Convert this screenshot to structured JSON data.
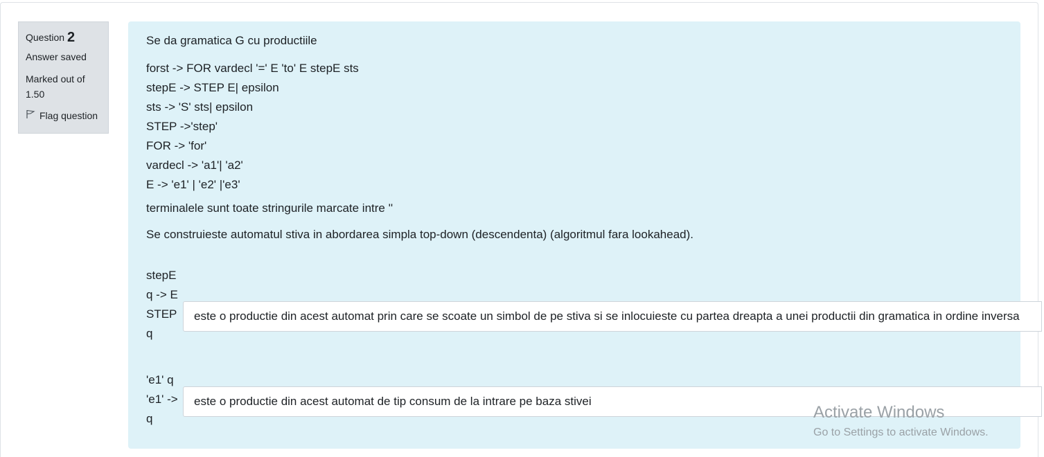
{
  "info": {
    "question_label": "Question",
    "question_number": "2",
    "state": "Answer saved",
    "grade": "Marked out of 1.50",
    "flag_label": "Flag question"
  },
  "question": {
    "intro": "Se da gramatica G cu productiile",
    "productions": [
      "forst -> FOR vardecl '=' E 'to' E stepE sts",
      "stepE -> STEP E| epsilon",
      "sts -> 'S' sts| epsilon",
      "STEP ->'step'",
      "FOR -> 'for'",
      "vardecl -> 'a1'| 'a2'",
      "E -> 'e1' | 'e2' |'e3'"
    ],
    "terminals_note": "terminalele sunt toate stringurile marcate intre ''",
    "automaton_note": "Se construieste automatul stiva in abordarea simpla top-down (descendenta) (algoritmul fara lookahead).",
    "items": [
      {
        "label": "stepE q -> E STEP q",
        "answer": "este o productie din acest automat prin care se scoate un simbol de pe stiva si se inlocuieste cu partea dreapta a unei productii din gramatica in ordine inversa"
      },
      {
        "label": "'e1' q 'e1' -> q",
        "answer": "este o productie din acest automat de tip consum de la intrare pe baza stivei"
      }
    ]
  },
  "watermark": {
    "title": "Activate Windows",
    "subtitle": "Go to Settings to activate Windows."
  }
}
